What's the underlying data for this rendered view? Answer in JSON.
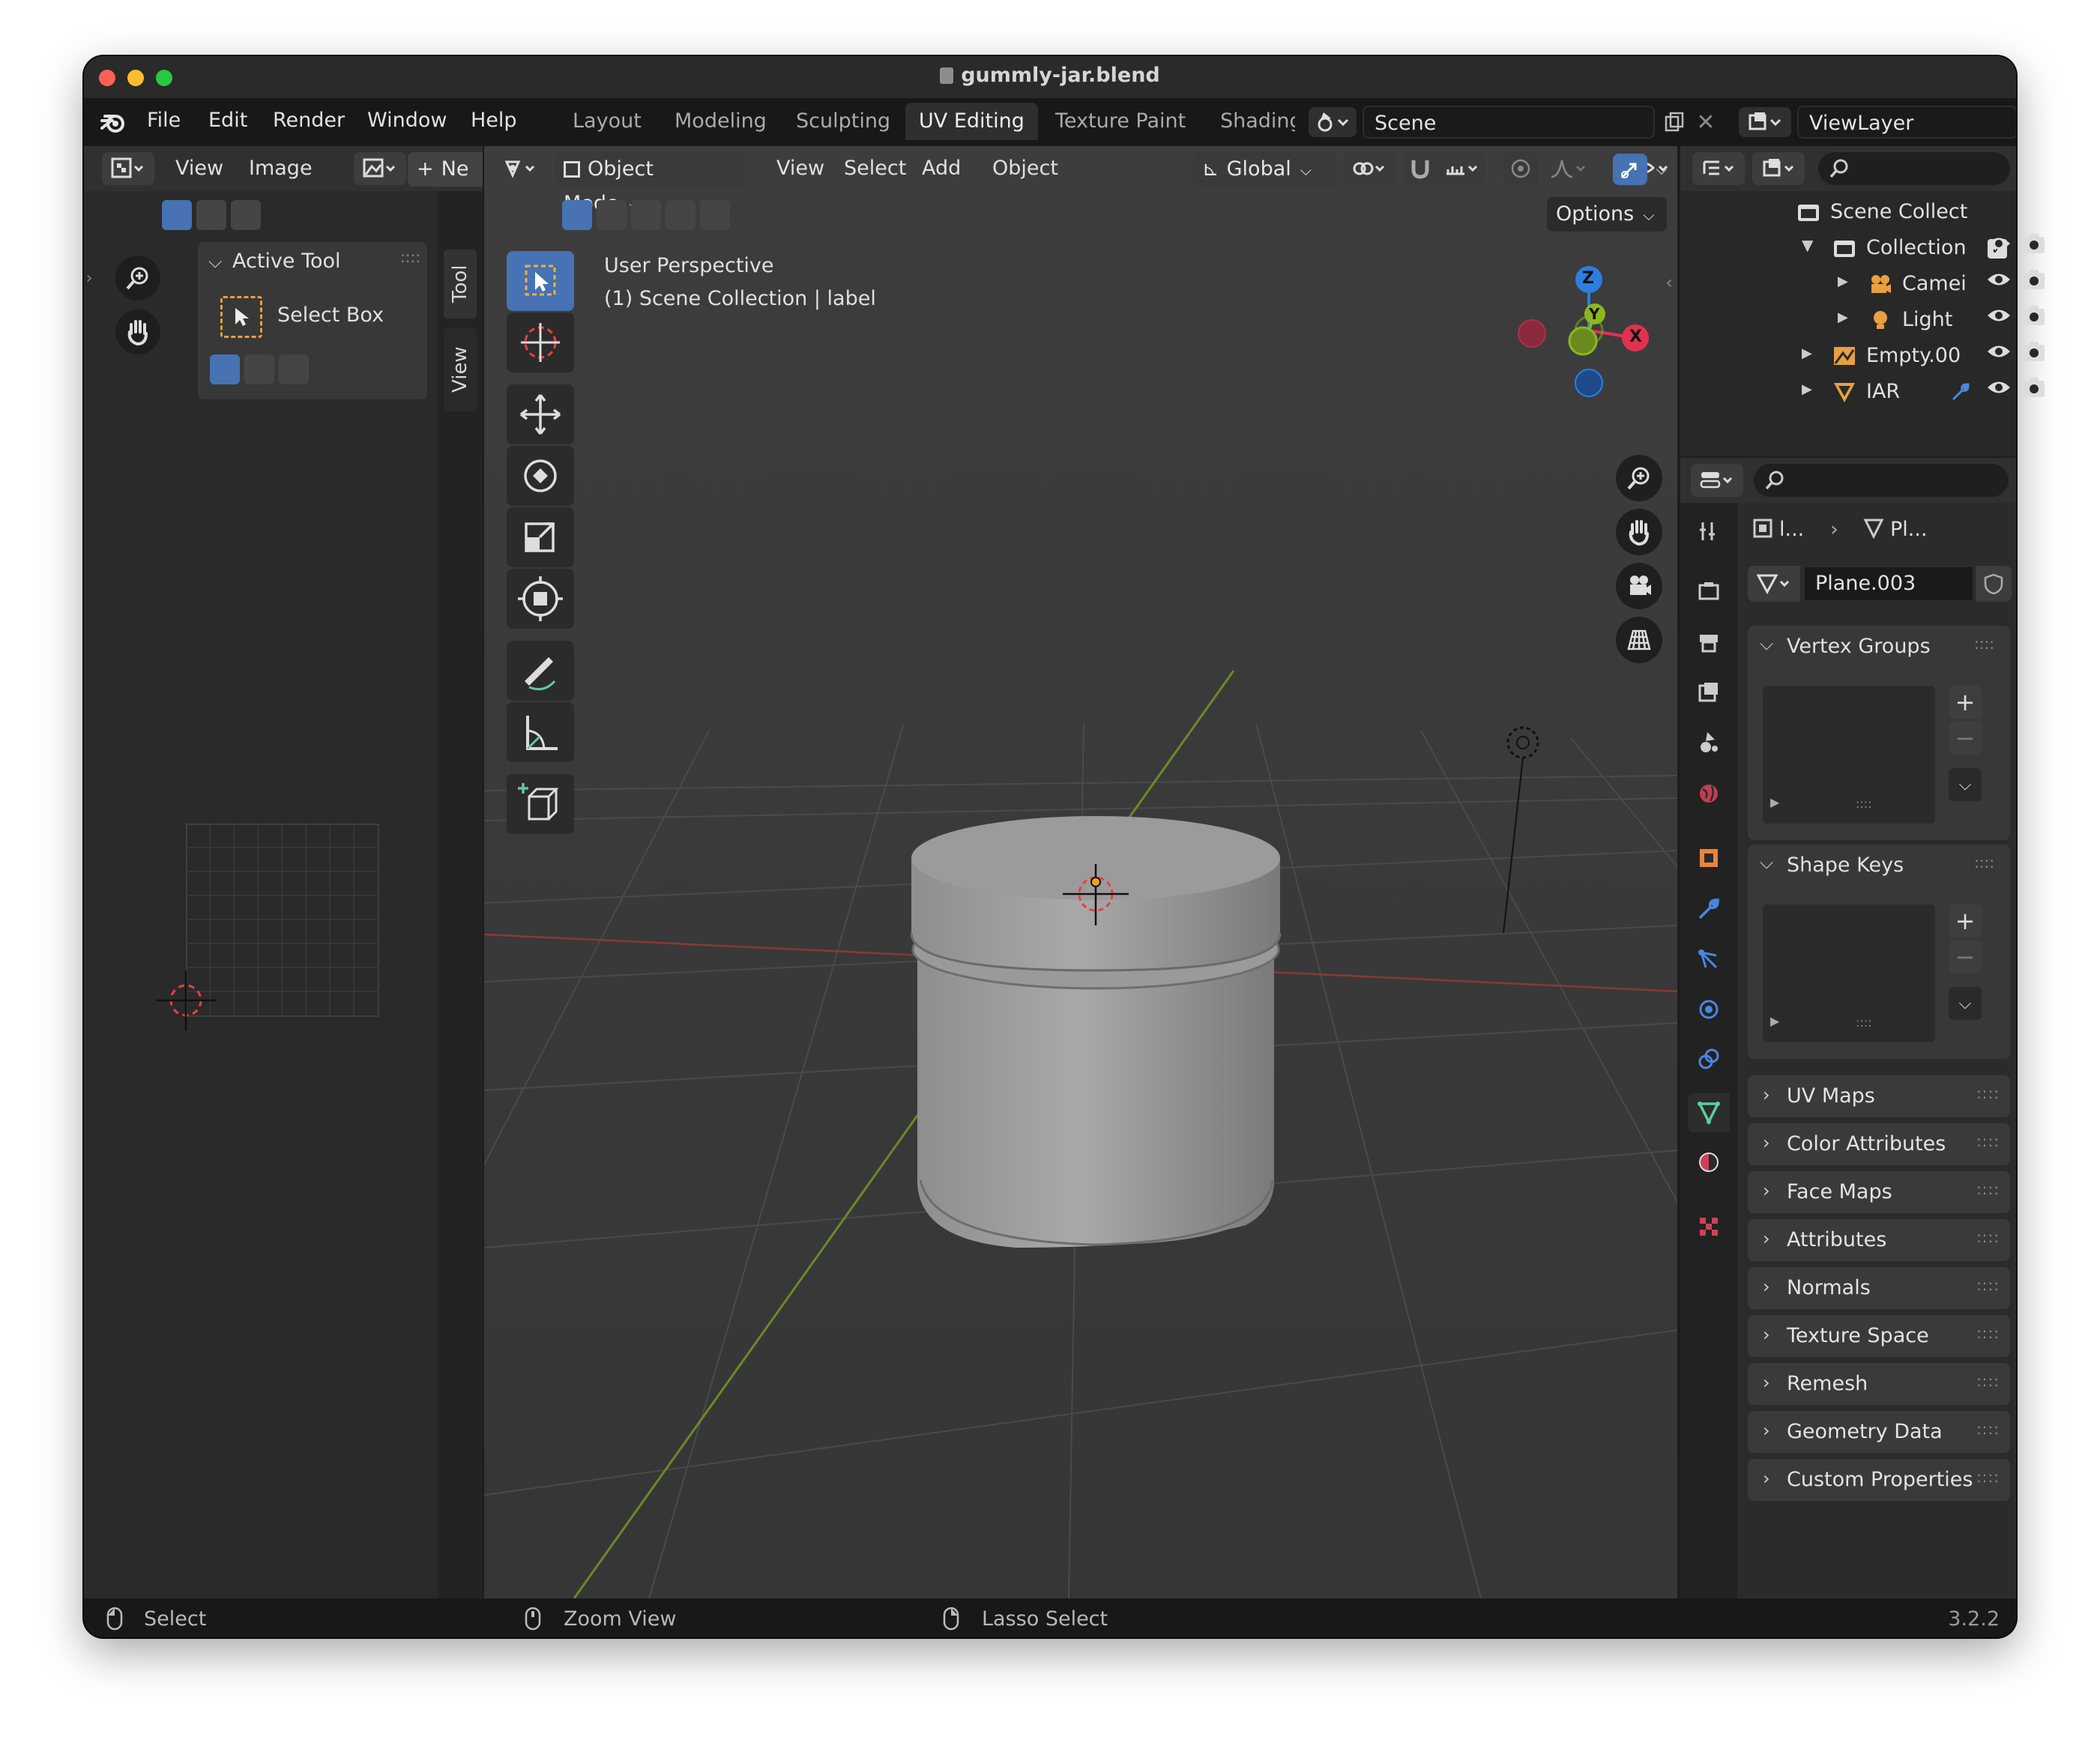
{
  "window": {
    "title": "gummly-jar.blend"
  },
  "menu": [
    "File",
    "Edit",
    "Render",
    "Window",
    "Help"
  ],
  "workspaces": [
    "Layout",
    "Modeling",
    "Sculpting",
    "UV Editing",
    "Texture Paint",
    "Shading"
  ],
  "scene": "Scene",
  "view_layer": "ViewLayer",
  "uv_editor": {
    "menus": [
      "View",
      "Image"
    ],
    "new_button": "Ne",
    "active_tool_heading": "Active Tool",
    "tool_name": "Select Box",
    "side_tabs": [
      "Tool",
      "View"
    ]
  },
  "viewport": {
    "mode": "Object Mode",
    "menus": [
      "View",
      "Select",
      "Add",
      "Object"
    ],
    "orientation": "Global",
    "options": "Options",
    "overlay_line1": "User Perspective",
    "overlay_line2": "(1) Scene Collection | label",
    "gizmo": {
      "x": "X",
      "y": "Y",
      "z": "Z"
    }
  },
  "outliner": {
    "rows": [
      {
        "label": "Scene Collect"
      },
      {
        "label": "Collection"
      },
      {
        "label": "Camei"
      },
      {
        "label": "Light"
      },
      {
        "label": "Empty.00"
      },
      {
        "label": "IAR"
      }
    ]
  },
  "properties": {
    "breadcrumb_1": "l...",
    "breadcrumb_2": "Pl...",
    "mesh_name": "Plane.003",
    "panels": [
      "Vertex Groups",
      "Shape Keys",
      "UV Maps",
      "Color Attributes",
      "Face Maps",
      "Attributes",
      "Normals",
      "Texture Space",
      "Remesh",
      "Geometry Data",
      "Custom Properties"
    ]
  },
  "status_bar": {
    "left": "Select",
    "middle": "Zoom View",
    "right": "Lasso Select",
    "version": "3.2.2"
  },
  "colors": {
    "accent": "#4772b3",
    "axis_x": "#e0324f",
    "axis_y": "#8bb81d",
    "axis_z": "#2c7ee0",
    "background": "#2d2d2d"
  }
}
